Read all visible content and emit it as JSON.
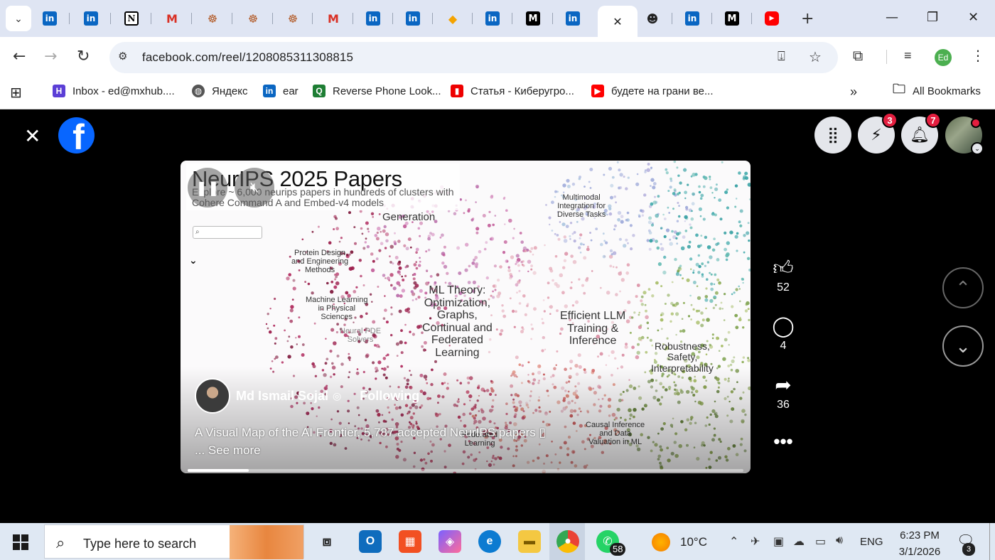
{
  "browser": {
    "tabs": [
      {
        "icon": "linkedin-icon",
        "glyph": "in"
      },
      {
        "icon": "linkedin-icon",
        "glyph": "in"
      },
      {
        "icon": "notion-icon",
        "glyph": "N"
      },
      {
        "icon": "gmail-icon",
        "glyph": "M"
      },
      {
        "icon": "mask-icon",
        "glyph": "☸"
      },
      {
        "icon": "mask-icon",
        "glyph": "☸"
      },
      {
        "icon": "mask-icon",
        "glyph": "☸"
      },
      {
        "icon": "gmail-icon",
        "glyph": "M"
      },
      {
        "icon": "linkedin-icon",
        "glyph": "in"
      },
      {
        "icon": "linkedin-icon",
        "glyph": "in"
      },
      {
        "icon": "box-icon",
        "glyph": "◆"
      },
      {
        "icon": "linkedin-icon",
        "glyph": "in"
      },
      {
        "icon": "medium-icon",
        "glyph": "M"
      },
      {
        "icon": "linkedin-icon",
        "glyph": "in"
      },
      {
        "icon": "close-icon",
        "glyph": "✕",
        "active": true
      },
      {
        "icon": "face-icon",
        "glyph": "☻"
      },
      {
        "icon": "linkedin-icon",
        "glyph": "in"
      },
      {
        "icon": "medium-icon",
        "glyph": "M"
      },
      {
        "icon": "youtube-icon",
        "glyph": "▶"
      }
    ],
    "url": "facebook.com/reel/1208085311308815",
    "profile_initials": "Ed",
    "bookmarks": [
      {
        "label": "Inbox - ed@mxhub....",
        "icon": "hub-icon"
      },
      {
        "label": "Яндекс",
        "icon": "globe-icon"
      },
      {
        "label": "ear",
        "icon": "linkedin-icon"
      },
      {
        "label": "Reverse Phone Look...",
        "icon": "search-icon"
      },
      {
        "label": "Статья - Киберугро...",
        "icon": "flag-icon"
      },
      {
        "label": "будете на грани ве...",
        "icon": "youtube-icon"
      }
    ],
    "all_bookmarks": "All Bookmarks"
  },
  "facebook": {
    "messenger_badge": "3",
    "notifications_badge": "7"
  },
  "reel": {
    "title": "NeurIPS 2025 Papers",
    "subtitle": "Explore ~ 6,000 neurips papers in hundreds of clusters with Cohere Command A and Embed-v4 models",
    "cluster_labels": [
      {
        "text": "Generation"
      },
      {
        "text": "Multimodal\nIntegration for\nDiverse Tasks"
      },
      {
        "text": "Protein Design\nand Engineering\nMethods"
      },
      {
        "text": "Machine Learning\nin Physical\nSciences"
      },
      {
        "text": "Neural PDE\nSolvers"
      },
      {
        "text": "ML Theory:\nOptimization,\nGraphs,\nContinual and\nFederated\nLearning"
      },
      {
        "text": "Efficient LLM\nTraining &\nInference"
      },
      {
        "text": "Robustness,\nSafety,\nInterpretability"
      },
      {
        "text": "Causal Inference\nand Data\nValuation in ML"
      },
      {
        "text": "Federated\nLearning"
      }
    ],
    "author": "Md Ismail Sojal",
    "follow_state": "Following",
    "caption_line1": "A Visual Map of the AI Frontier, 5,787 accepted NeurIPS papers ▯",
    "caption_line2": "... See more",
    "progress": 0.11
  },
  "actions": {
    "likes": "52",
    "comments": "4",
    "shares": "36"
  },
  "taskbar": {
    "search_placeholder": "Type here to search",
    "whatsapp_badge": "58",
    "temperature": "10°C",
    "language": "ENG",
    "time": "6:23 PM",
    "date": "3/1/2026",
    "notification_count": "3"
  },
  "colors": {
    "facebook_blue": "#0866ff",
    "badge_red": "#e41e3f",
    "chrome_tabstrip": "#dfe5f3"
  }
}
